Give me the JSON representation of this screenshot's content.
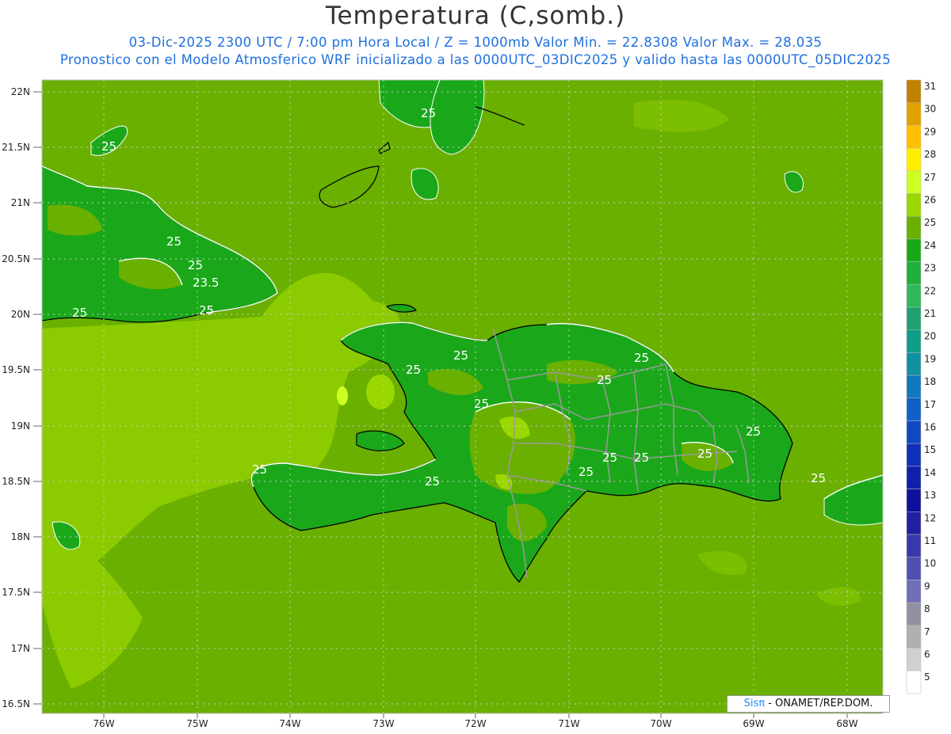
{
  "header": {
    "title": "Temperatura (C,somb.)",
    "subtitle_line1": "03-Dic-2025  2300 UTC / 7:00 pm Hora Local / Z = 1000mb    Valor Min. = 22.8308  Valor Max. = 28.035",
    "subtitle_line2": "Pronostico con el Modelo Atmosferico WRF inicializado a las 0000UTC_03DIC2025 y valido hasta las  0000UTC_05DIC2025"
  },
  "axes": {
    "lat_labels": [
      "22N",
      "21.5N",
      "21N",
      "20.5N",
      "20N",
      "19.5N",
      "19N",
      "18.5N",
      "18N",
      "17.5N",
      "17N",
      "16.5N"
    ],
    "lon_labels": [
      "76W",
      "75W",
      "74W",
      "73W",
      "72W",
      "71W",
      "70W",
      "69W",
      "68W"
    ]
  },
  "contour_labels": [
    "25",
    "25",
    "25",
    "25",
    "23.5",
    "25",
    "25",
    "25",
    "25",
    "25",
    "25",
    "25",
    "25",
    "25",
    "25",
    "25",
    "25",
    "25",
    "25",
    "25"
  ],
  "colorbar": {
    "levels": [
      "31",
      "30",
      "29",
      "28",
      "27",
      "26",
      "25",
      "24",
      "23",
      "22",
      "21",
      "20",
      "19",
      "18",
      "17",
      "16",
      "15",
      "14",
      "13",
      "12",
      "11",
      "10",
      "9",
      "8",
      "7",
      "6",
      "5"
    ],
    "colors": [
      "#c08000",
      "#e0a000",
      "#ffc000",
      "#ffee00",
      "#ccff22",
      "#9bd700",
      "#6ab000",
      "#1aa81a",
      "#22b03c",
      "#30b858",
      "#20a070",
      "#109c88",
      "#1090a0",
      "#1078c0",
      "#1060c8",
      "#1048c0",
      "#1030b8",
      "#1020a8",
      "#10109c",
      "#2020a0",
      "#3838a8",
      "#5050b0",
      "#7070b8",
      "#9090a0",
      "#b0b0b0",
      "#d0d0d0",
      "#ffffff"
    ]
  },
  "credit": {
    "brand": "Sisπ",
    "text": " - ONAMET/REP.DOM."
  },
  "colors": {
    "ocean_base": "#6ab000",
    "warm_sea": "#9bd700",
    "land_cool": "#1aa81a",
    "land_warm": "#6ab000",
    "peak": "#ccff22",
    "coast": "#000000",
    "contour": "#ffffff",
    "borders": "#999999"
  }
}
